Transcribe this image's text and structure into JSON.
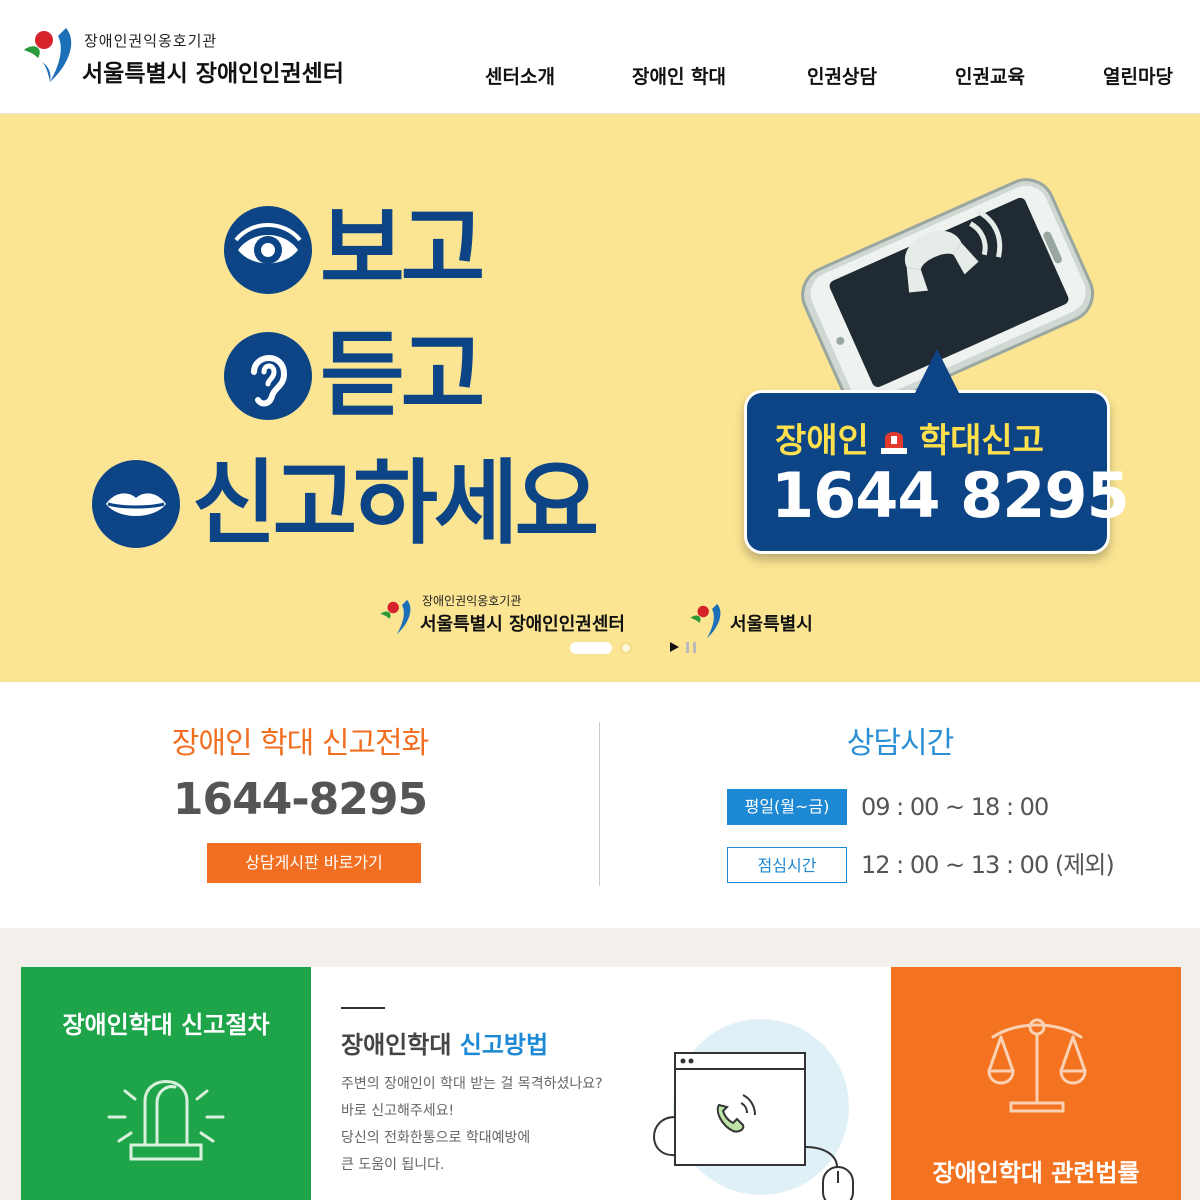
{
  "header": {
    "logo_sub": "장애인권익옹호기관",
    "logo_main": "서울특별시 장애인인권센터",
    "nav": [
      "센터소개",
      "장애인 학대",
      "인권상담",
      "인권교육",
      "열린마당"
    ]
  },
  "banner": {
    "slogan": [
      "보고",
      "듣고",
      "신고하세요"
    ],
    "callout_top_left": "장애인",
    "callout_top_right": "학대신고",
    "callout_number": "1644 8295",
    "logo_sub": "장애인권익옹호기관",
    "logo_main": "서울특별시 장애인인권센터",
    "logo_city": "서울특별시"
  },
  "hotline": {
    "title": "장애인 학대 신고전화",
    "number": "1644-8295",
    "board_button": "상담게시판 바로가기"
  },
  "consult": {
    "title": "상담시간",
    "rows": [
      {
        "label": "평일(월~금)",
        "time": "09 : 00 ~ 18 : 00"
      },
      {
        "label": "점심시간",
        "time": "12 : 00 ~ 13 : 00 (제외)"
      }
    ]
  },
  "quick": {
    "procedure_title": "장애인학대 신고절차",
    "method_title_a": "장애인학대",
    "method_title_b": "신고방법",
    "method_desc": [
      "주변의 장애인이 학대 받는 걸 목격하셨나요?",
      "바로 신고해주세요!",
      "당신의 전화한통으로 학대예방에",
      "큰 도움이 됩니다."
    ],
    "law_title": "장애인학대 관련법률"
  },
  "colors": {
    "navy": "#0c4486",
    "banner_bg": "#fbe593",
    "orange": "#f26f22",
    "blue": "#1d88d3",
    "green": "#1ea54a"
  }
}
